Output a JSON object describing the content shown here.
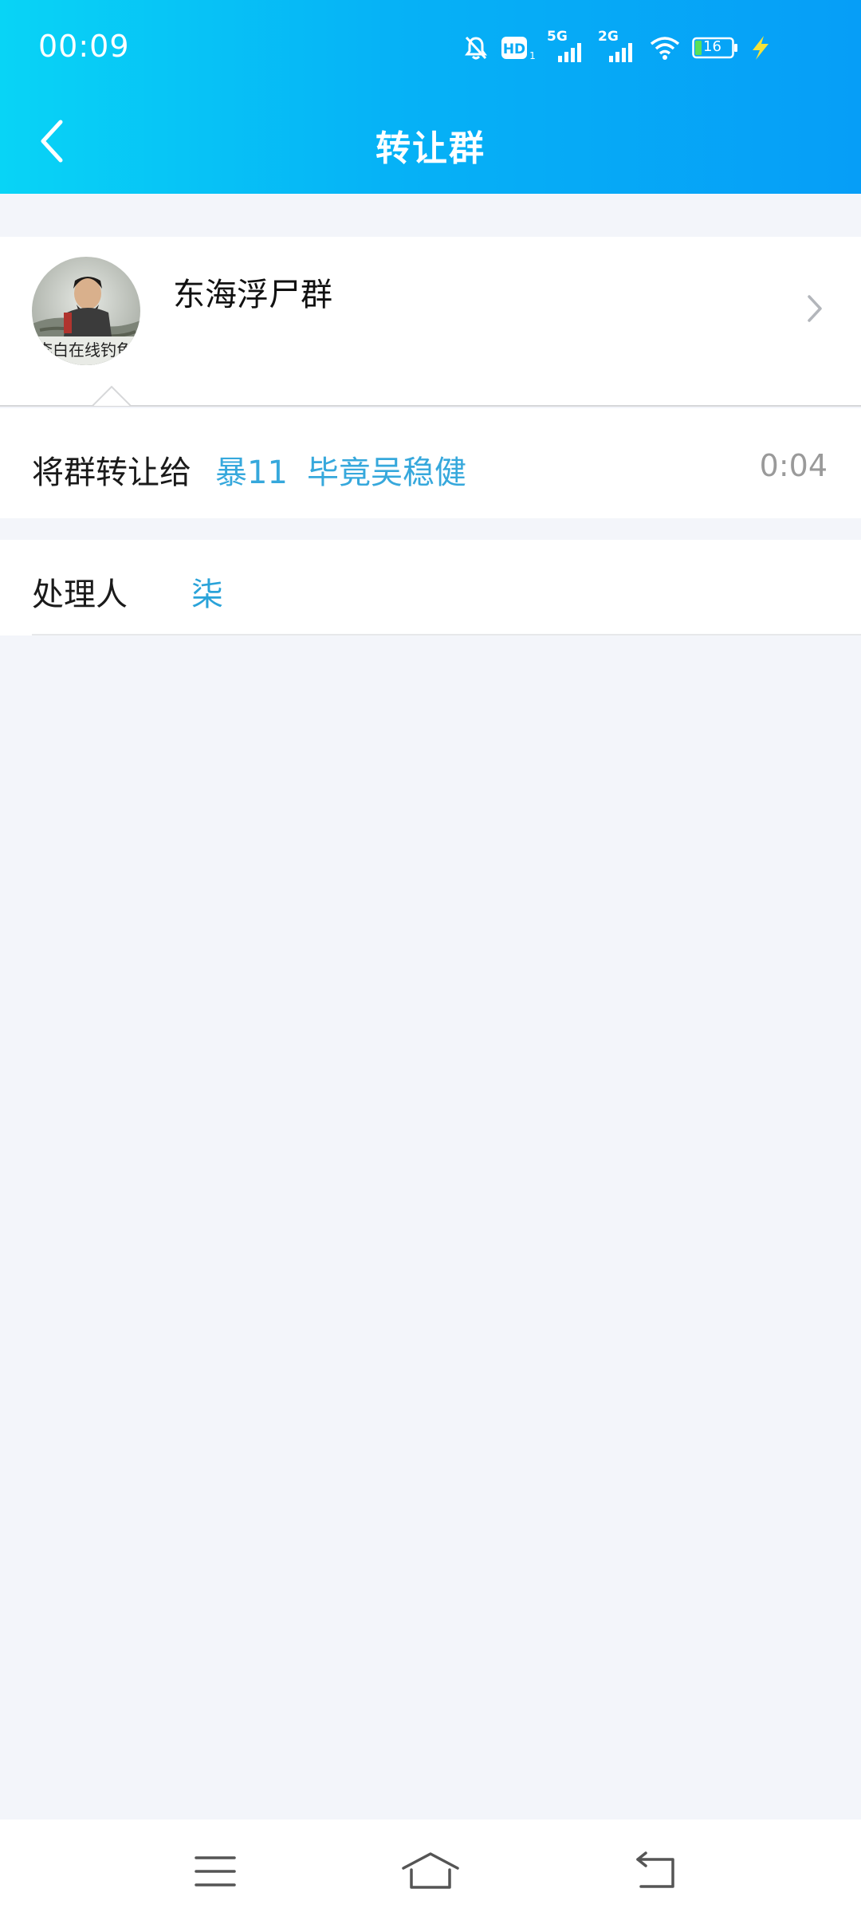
{
  "status_bar": {
    "time": "00:09",
    "network_5g": "5G",
    "network_2g": "2G",
    "battery": "16",
    "icons": [
      "bell-off-icon",
      "hd-icon",
      "signal-5g-icon",
      "signal-2g-icon",
      "wifi-icon",
      "battery-icon",
      "charging-icon"
    ]
  },
  "header": {
    "title": "转让群",
    "back_icon": "chevron-left-icon"
  },
  "group": {
    "name": "东海浮尸群",
    "avatar_caption": "李白在线钓鱼"
  },
  "transfer": {
    "label": "将群转让给",
    "users": [
      "暴11",
      "毕竟吴稳健"
    ],
    "time": "0:04"
  },
  "handler": {
    "label": "处理人",
    "value": "柒"
  },
  "colors": {
    "header_start": "#08d4f6",
    "header_end": "#069ef7",
    "link": "#36a8dc",
    "background": "#f3f5fa"
  },
  "bottom_nav": {
    "icons": [
      "menu-icon",
      "home-icon",
      "back-icon"
    ]
  }
}
